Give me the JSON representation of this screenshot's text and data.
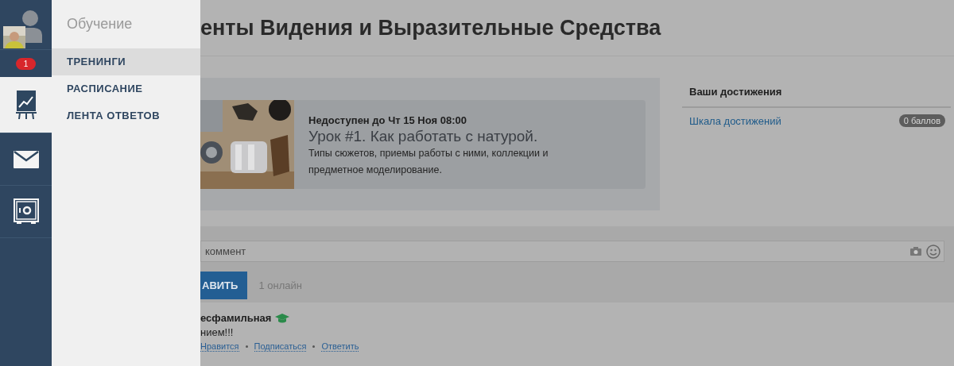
{
  "rail": {
    "notification_count": "1",
    "items": [
      {
        "kind": "chart",
        "selected": true
      },
      {
        "kind": "mail",
        "selected": false
      },
      {
        "kind": "safe",
        "selected": false
      }
    ]
  },
  "menu": {
    "title": "Обучение",
    "items": [
      {
        "label": "ТРЕНИНГИ",
        "selected": true
      },
      {
        "label": "РАСПИСАНИЕ",
        "selected": false
      },
      {
        "label": "ЛЕНТА ОТВЕТОВ",
        "selected": false
      }
    ]
  },
  "page": {
    "title": "енты Видения и Выразительные Средства"
  },
  "lesson": {
    "availability": "Недоступен до Чт 15 Ноя 08:00",
    "title": "Урок #1. Как работать с натурой.",
    "description": "Типы сюжетов, приемы работы с ними, коллекции и предметное моделирование."
  },
  "achievements": {
    "title": "Ваши достижения",
    "link": "Шкала достижений",
    "points": "0 баллов"
  },
  "comment_form": {
    "placeholder": "коммент",
    "button": "АВИТЬ",
    "online": "1 онлайн"
  },
  "comments": [
    {
      "author": "есфамильная",
      "text": "нием!!!",
      "actions": [
        "Нравится",
        "Подписаться",
        "Ответить"
      ]
    }
  ]
}
